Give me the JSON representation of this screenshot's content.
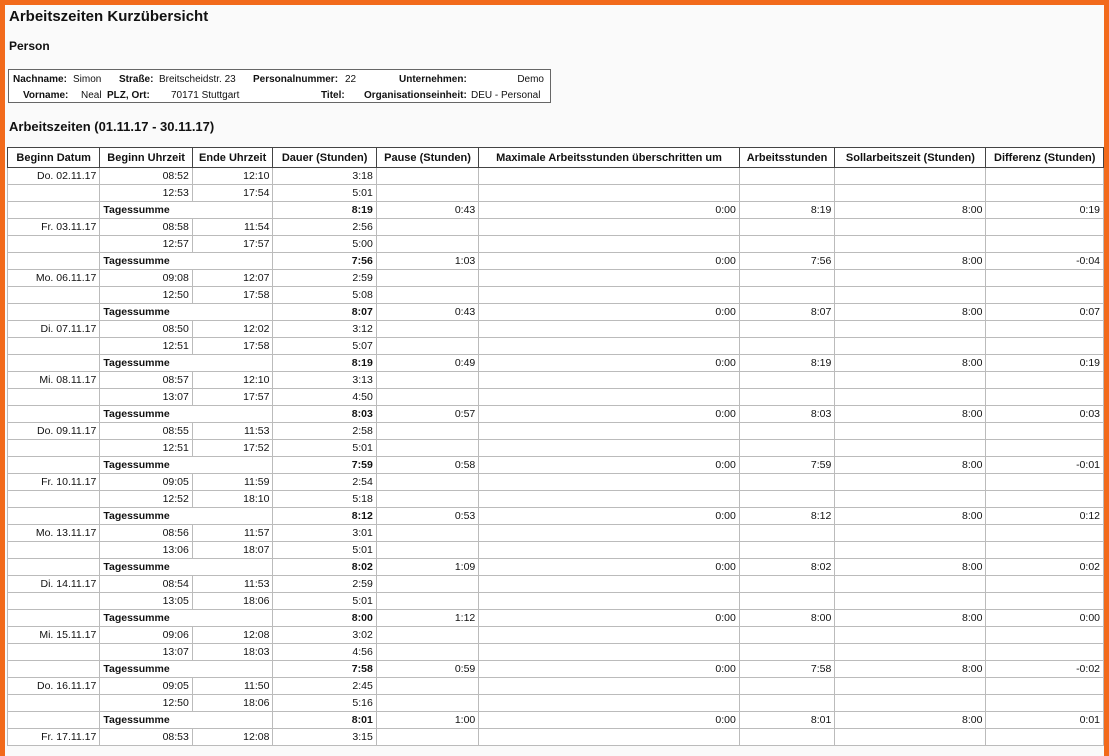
{
  "doc": {
    "title": "Arbeitszeiten Kurzübersicht",
    "person_heading": "Person",
    "range_heading": "Arbeitszeiten (01.11.17 - 30.11.17)"
  },
  "person": {
    "nachname_label": "Nachname:",
    "nachname": "Simon",
    "vorname_label": "Vorname:",
    "vorname": "Neal",
    "strasse_label": "Straße:",
    "strasse": "Breitscheidstr. 23",
    "plz_label": "PLZ, Ort:",
    "plz": "70171 Stuttgart",
    "personalnummer_label": "Personalnummer:",
    "personalnummer": "22",
    "titel_label": "Titel:",
    "titel": "",
    "unternehmen_label": "Unternehmen:",
    "unternehmen": "Demo",
    "org_label": "Organisationseinheit:",
    "org": "DEU - Personal"
  },
  "table": {
    "headers": [
      "Beginn Datum",
      "Beginn Uhrzeit",
      "Ende Uhrzeit",
      "Dauer (Stunden)",
      "Pause (Stunden)",
      "Maximale Arbeitsstunden überschritten um",
      "Arbeitsstunden",
      "Sollarbeitszeit (Stunden)",
      "Differenz (Stunden)"
    ],
    "sum_label": "Tagessumme",
    "days": [
      {
        "date": "Do. 02.11.17",
        "entries": [
          [
            "08:52",
            "12:10",
            "3:18"
          ],
          [
            "12:53",
            "17:54",
            "5:01"
          ]
        ],
        "sum": {
          "dauer": "8:19",
          "pause": "0:43",
          "max": "0:00",
          "arbeit": "8:19",
          "soll": "8:00",
          "diff": "0:19"
        }
      },
      {
        "date": "Fr. 03.11.17",
        "entries": [
          [
            "08:58",
            "11:54",
            "2:56"
          ],
          [
            "12:57",
            "17:57",
            "5:00"
          ]
        ],
        "sum": {
          "dauer": "7:56",
          "pause": "1:03",
          "max": "0:00",
          "arbeit": "7:56",
          "soll": "8:00",
          "diff": "-0:04"
        }
      },
      {
        "date": "Mo. 06.11.17",
        "entries": [
          [
            "09:08",
            "12:07",
            "2:59"
          ],
          [
            "12:50",
            "17:58",
            "5:08"
          ]
        ],
        "sum": {
          "dauer": "8:07",
          "pause": "0:43",
          "max": "0:00",
          "arbeit": "8:07",
          "soll": "8:00",
          "diff": "0:07"
        }
      },
      {
        "date": "Di. 07.11.17",
        "entries": [
          [
            "08:50",
            "12:02",
            "3:12"
          ],
          [
            "12:51",
            "17:58",
            "5:07"
          ]
        ],
        "sum": {
          "dauer": "8:19",
          "pause": "0:49",
          "max": "0:00",
          "arbeit": "8:19",
          "soll": "8:00",
          "diff": "0:19"
        }
      },
      {
        "date": "Mi. 08.11.17",
        "entries": [
          [
            "08:57",
            "12:10",
            "3:13"
          ],
          [
            "13:07",
            "17:57",
            "4:50"
          ]
        ],
        "sum": {
          "dauer": "8:03",
          "pause": "0:57",
          "max": "0:00",
          "arbeit": "8:03",
          "soll": "8:00",
          "diff": "0:03"
        }
      },
      {
        "date": "Do. 09.11.17",
        "entries": [
          [
            "08:55",
            "11:53",
            "2:58"
          ],
          [
            "12:51",
            "17:52",
            "5:01"
          ]
        ],
        "sum": {
          "dauer": "7:59",
          "pause": "0:58",
          "max": "0:00",
          "arbeit": "7:59",
          "soll": "8:00",
          "diff": "-0:01"
        }
      },
      {
        "date": "Fr. 10.11.17",
        "entries": [
          [
            "09:05",
            "11:59",
            "2:54"
          ],
          [
            "12:52",
            "18:10",
            "5:18"
          ]
        ],
        "sum": {
          "dauer": "8:12",
          "pause": "0:53",
          "max": "0:00",
          "arbeit": "8:12",
          "soll": "8:00",
          "diff": "0:12"
        }
      },
      {
        "date": "Mo. 13.11.17",
        "entries": [
          [
            "08:56",
            "11:57",
            "3:01"
          ],
          [
            "13:06",
            "18:07",
            "5:01"
          ]
        ],
        "sum": {
          "dauer": "8:02",
          "pause": "1:09",
          "max": "0:00",
          "arbeit": "8:02",
          "soll": "8:00",
          "diff": "0:02"
        }
      },
      {
        "date": "Di. 14.11.17",
        "entries": [
          [
            "08:54",
            "11:53",
            "2:59"
          ],
          [
            "13:05",
            "18:06",
            "5:01"
          ]
        ],
        "sum": {
          "dauer": "8:00",
          "pause": "1:12",
          "max": "0:00",
          "arbeit": "8:00",
          "soll": "8:00",
          "diff": "0:00"
        }
      },
      {
        "date": "Mi. 15.11.17",
        "entries": [
          [
            "09:06",
            "12:08",
            "3:02"
          ],
          [
            "13:07",
            "18:03",
            "4:56"
          ]
        ],
        "sum": {
          "dauer": "7:58",
          "pause": "0:59",
          "max": "0:00",
          "arbeit": "7:58",
          "soll": "8:00",
          "diff": "-0:02"
        }
      },
      {
        "date": "Do. 16.11.17",
        "entries": [
          [
            "09:05",
            "11:50",
            "2:45"
          ],
          [
            "12:50",
            "18:06",
            "5:16"
          ]
        ],
        "sum": {
          "dauer": "8:01",
          "pause": "1:00",
          "max": "0:00",
          "arbeit": "8:01",
          "soll": "8:00",
          "diff": "0:01"
        }
      },
      {
        "date": "Fr. 17.11.17",
        "entries": [
          [
            "08:53",
            "12:08",
            "3:15"
          ]
        ],
        "sum": null
      }
    ]
  }
}
